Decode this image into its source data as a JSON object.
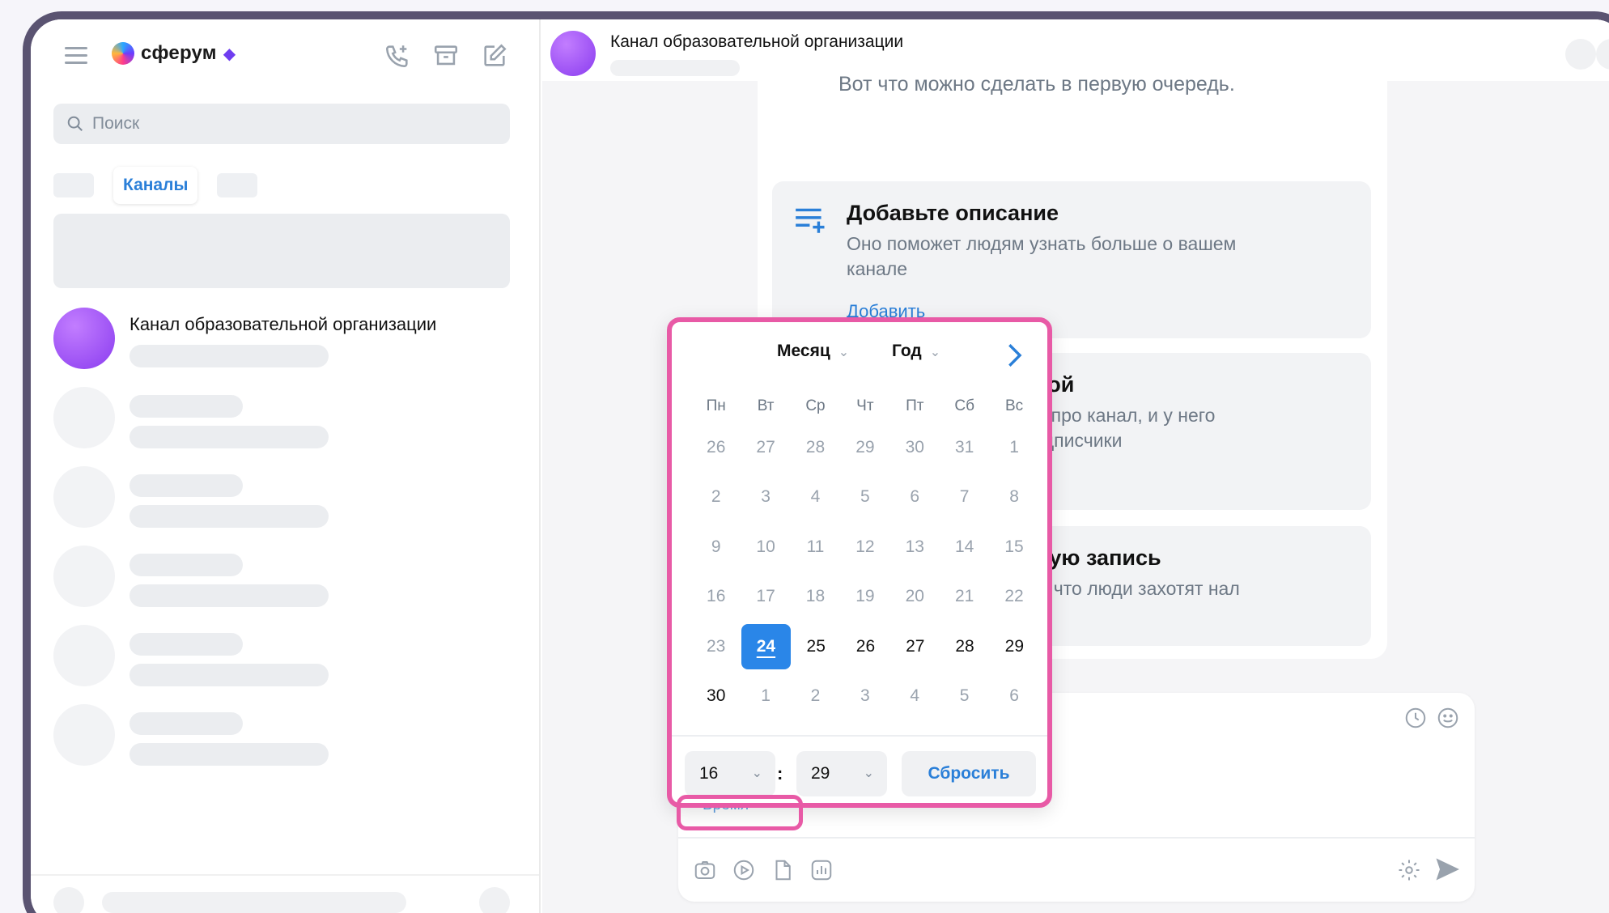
{
  "app": {
    "logo_text": "сферум"
  },
  "sidebar": {
    "search_placeholder": "Поиск",
    "tab_active": "Каналы",
    "chats": [
      {
        "title": "Канал образовательной организации"
      }
    ]
  },
  "header": {
    "title": "Канал образовательной организации"
  },
  "intro": {
    "text": "Вот что можно сделать в первую очередь.",
    "cards": [
      {
        "title": "Добавьте описание",
        "desc": "Оно поможет людям узнать больше о вашем канале",
        "link": "Добавить"
      },
      {
        "title": "лкой",
        "desc": "ям про канал, и у него подписчики"
      },
      {
        "title": "рвую запись",
        "desc": "ов, что люди захотят нал"
      }
    ]
  },
  "calendar": {
    "month_label": "Месяц",
    "year_label": "Год",
    "weekdays": [
      "Пн",
      "Вт",
      "Ср",
      "Чт",
      "Пт",
      "Сб",
      "Вс"
    ],
    "weeks": [
      [
        "26",
        "27",
        "28",
        "29",
        "30",
        "31",
        "1"
      ],
      [
        "2",
        "3",
        "4",
        "5",
        "6",
        "7",
        "8"
      ],
      [
        "9",
        "10",
        "11",
        "12",
        "13",
        "14",
        "15"
      ],
      [
        "16",
        "17",
        "18",
        "19",
        "20",
        "21",
        "22"
      ],
      [
        "23",
        "24",
        "25",
        "26",
        "27",
        "28",
        "29"
      ],
      [
        "30",
        "1",
        "2",
        "3",
        "4",
        "5",
        "6"
      ]
    ],
    "selected_day": "24",
    "hour": "16",
    "minute": "29",
    "colon": ":",
    "reset_label": "Сбросить"
  },
  "composer": {
    "tag_label": "Время",
    "tag_close": "×"
  },
  "colors": {
    "accent": "#2a86e8",
    "highlight": "#e85aa6",
    "frame": "#5a5371"
  }
}
